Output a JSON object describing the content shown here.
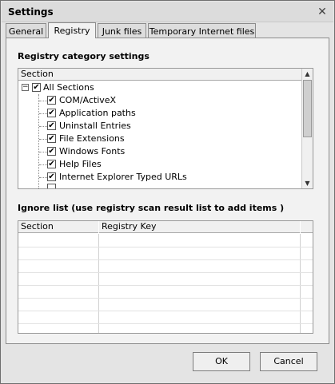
{
  "window": {
    "title": "Settings",
    "close_glyph": "✕"
  },
  "tabs": [
    {
      "label": "General",
      "active": false
    },
    {
      "label": "Registry",
      "active": true
    },
    {
      "label": "Junk files",
      "active": false
    },
    {
      "label": "Temporary Internet files",
      "active": false
    }
  ],
  "registry": {
    "category_label": "Registry category settings",
    "column_header": "Section",
    "root": {
      "label": "All Sections",
      "checked": true,
      "expanded": true
    },
    "items": [
      {
        "label": "COM/ActiveX",
        "checked": true
      },
      {
        "label": "Application paths",
        "checked": true
      },
      {
        "label": "Uninstall Entries",
        "checked": true
      },
      {
        "label": "File Extensions",
        "checked": true
      },
      {
        "label": "Windows Fonts",
        "checked": true
      },
      {
        "label": "Help Files",
        "checked": true
      },
      {
        "label": "Internet Explorer Typed URLs",
        "checked": true
      }
    ]
  },
  "ignore": {
    "label": "Ignore list (use registry scan result list to add items )",
    "columns": [
      "Section",
      "Registry Key"
    ],
    "rows": []
  },
  "buttons": {
    "ok": "OK",
    "cancel": "Cancel"
  }
}
